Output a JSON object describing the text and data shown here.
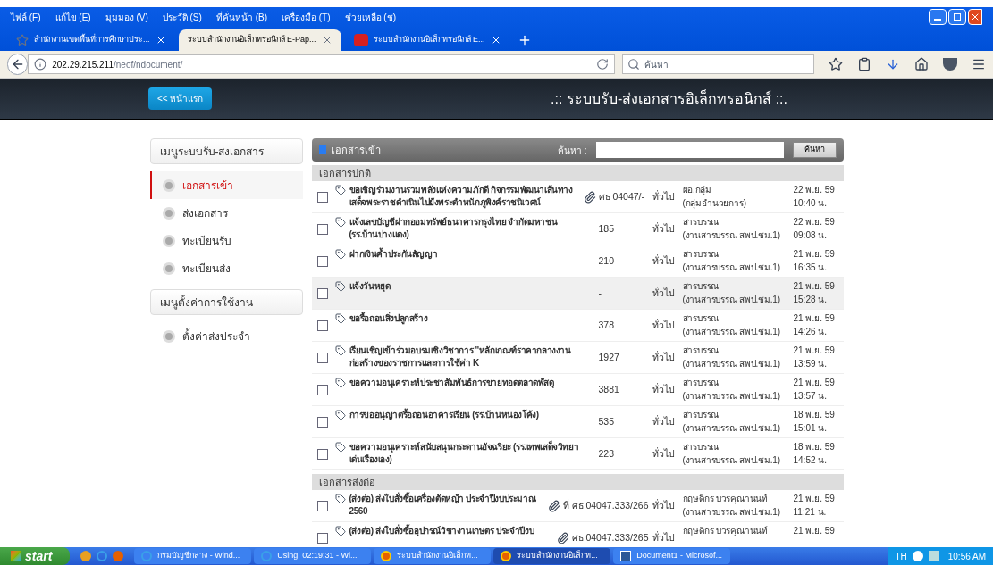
{
  "menu": [
    "ไฟล์ (F)",
    "แก้ไข (E)",
    "มุมมอง (V)",
    "ประวัติ (S)",
    "ที่คั่นหน้า (B)",
    "เครื่องมือ (T)",
    "ช่วยเหลือ (ช)"
  ],
  "tabs": [
    {
      "label": "สำนักงานเขตพื้นที่การศึกษาประ...",
      "selected": false
    },
    {
      "label": "ระบบสำนักงานอิเล็กทรอนิกส์ E-Pap...",
      "selected": true
    },
    {
      "label": "ระบบสำนักงานอิเล็กทรอนิกส์ E...",
      "selected": false
    }
  ],
  "address": {
    "host": "202.29.215.211",
    "path": "/neof/ndocument/"
  },
  "browser_search": {
    "placeholder": "ค้นหา"
  },
  "header": {
    "home_button": "<< หน้าแรก",
    "title": ".:: ระบบรับ-ส่งเอกสารอิเล็กทรอนิกส์ ::."
  },
  "sidebar": [
    {
      "title": "เมนูระบบรับ-ส่งเอกสาร",
      "items": [
        {
          "label": "เอกสารเข้า",
          "selected": true
        },
        {
          "label": "ส่งเอกสาร",
          "selected": false
        },
        {
          "label": "ทะเบียนรับ",
          "selected": false
        },
        {
          "label": "ทะเบียนส่ง",
          "selected": false
        }
      ]
    },
    {
      "title": "เมนูตั้งค่าการใช้งาน",
      "items": [
        {
          "label": "ตั้งค่าส่งประจำ",
          "selected": false
        }
      ]
    }
  ],
  "panel": {
    "title": "เอกสารเข้า",
    "search_label": "ค้นหา :",
    "search_button": "ค้นหา"
  },
  "groups": [
    {
      "title": "เอกสารปกติ",
      "rows": [
        {
          "title": "ขอเชิญร่วมงานรวมพลังแห่งความภักดี กิจกรรมพัฒนาเส้นทางเสด็จพระราชดำเนินไปยังพระตำหนักภูพิงค์ราชนิเวศน์",
          "attachment": true,
          "number": "ศธ 04047/-",
          "type": "ทั่วไป",
          "sender": "ผอ.กลุ่ม",
          "unit": "(กลุ่มอำนวยการ)",
          "date": "22 พ.ย. 59",
          "time": "10:40 น.",
          "highlighted": false
        },
        {
          "title": "แจ้งเลขบัญชีฝากออมทรัพย์ธนาคารกรุงไทย จำกัดมหาชน (รร.บ้านปางแดง)",
          "attachment": false,
          "number": "185",
          "type": "ทั่วไป",
          "sender": "สารบรรณ",
          "unit": "(งานสารบรรณ สพป.ชม.1)",
          "date": "22 พ.ย. 59",
          "time": "09:08 น.",
          "highlighted": false
        },
        {
          "title": "ฝากเงินค้ำประกันสัญญา",
          "attachment": false,
          "number": "210",
          "type": "ทั่วไป",
          "sender": "สารบรรณ",
          "unit": "(งานสารบรรณ สพป.ชม.1)",
          "date": "21 พ.ย. 59",
          "time": "16:35 น.",
          "highlighted": false
        },
        {
          "title": "แจ้งวันหยุด",
          "attachment": false,
          "number": "-",
          "type": "ทั่วไป",
          "sender": "สารบรรณ",
          "unit": "(งานสารบรรณ สพป.ชม.1)",
          "date": "21 พ.ย. 59",
          "time": "15:28 น.",
          "highlighted": true
        },
        {
          "title": "ขอรื้อถอนสิ่งปลูกสร้าง",
          "attachment": false,
          "number": "378",
          "type": "ทั่วไป",
          "sender": "สารบรรณ",
          "unit": "(งานสารบรรณ สพป.ชม.1)",
          "date": "21 พ.ย. 59",
          "time": "14:26 น.",
          "highlighted": false
        },
        {
          "title": "เรียนเชิญเข้าร่วมอบรมเชิงวิชาการ \"หลักเกณฑ์ราคากลางงานก่อสร้างของราชการและการใช้ค่า K",
          "attachment": false,
          "number": "1927",
          "type": "ทั่วไป",
          "sender": "สารบรรณ",
          "unit": "(งานสารบรรณ สพป.ชม.1)",
          "date": "21 พ.ย. 59",
          "time": "13:59 น.",
          "highlighted": false
        },
        {
          "title": "ขอความอนุเคราะห์ประชาสัมพันธ์การขายทอดตลาดพัสดุ",
          "attachment": false,
          "number": "3881",
          "type": "ทั่วไป",
          "sender": "สารบรรณ",
          "unit": "(งานสารบรรณ สพป.ชม.1)",
          "date": "21 พ.ย. 59",
          "time": "13:57 น.",
          "highlighted": false
        },
        {
          "title": "การขออนุญาตรื้อถอนอาคารเรียน (รร.บ้านหนองโค้ง)",
          "attachment": false,
          "number": "535",
          "type": "ทั่วไป",
          "sender": "สารบรรณ",
          "unit": "(งานสารบรรณ สพป.ชม.1)",
          "date": "18 พ.ย. 59",
          "time": "15:01 น.",
          "highlighted": false
        },
        {
          "title": "ขอความอนุเคราะห์สนับสนุนกระดานอัจฉริยะ (รร.เทพเสด็จวิทยา เด่นเรืองเอง)",
          "attachment": false,
          "number": "223",
          "type": "ทั่วไป",
          "sender": "สารบรรณ",
          "unit": "(งานสารบรรณ สพป.ชม.1)",
          "date": "18 พ.ย. 59",
          "time": "14:52 น.",
          "highlighted": false
        }
      ]
    },
    {
      "title": "เอกสารส่งต่อ",
      "rows": [
        {
          "title": "(ส่งต่อ) ส่งใบสั่งซื้อเครื่องตัดหญ้า ประจำปีงบประมาณ 2560",
          "attachment": true,
          "number": "ที่ ศธ 04047.333/266",
          "type": "ทั่วไป",
          "sender": "กฤษดิกร บวรคุณานนท์",
          "unit": "(งานสารบรรณ สพป.ชม.1)",
          "date": "21 พ.ย. 59",
          "time": "11:21 น.",
          "highlighted": false
        },
        {
          "title": "(ส่งต่อ) ส่งใบสั่งซื้ออุปกรณ์วิชางานเกษตร ประจำปีงบ",
          "attachment": true,
          "number": "ศธ 04047.333/265",
          "type": "ทั่วไป",
          "sender": "กฤษดิกร บวรคุณานนท์",
          "date": "21 พ.ย. 59",
          "highlighted": false
        }
      ]
    }
  ],
  "taskbar": {
    "start": "start",
    "tasks": [
      {
        "label": "กรมบัญชีกลาง - Wind...",
        "selected": false
      },
      {
        "label": "Using: 02:19:31 - Wi...",
        "selected": false
      },
      {
        "label": "ระบบสำนักงานอิเล็กท...",
        "selected": false
      },
      {
        "label": "ระบบสำนักงานอิเล็กท...",
        "selected": true
      },
      {
        "label": "Document1 - Microsof...",
        "selected": false
      }
    ],
    "lang": "TH",
    "clock": "10:56 AM"
  }
}
